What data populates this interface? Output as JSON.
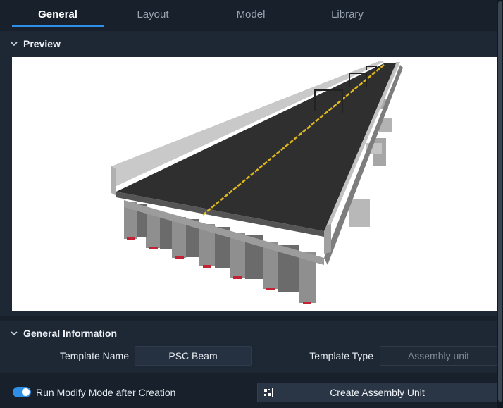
{
  "tabs": [
    {
      "label": "General",
      "active": true
    },
    {
      "label": "Layout",
      "active": false
    },
    {
      "label": "Model",
      "active": false
    },
    {
      "label": "Library",
      "active": false
    }
  ],
  "preview": {
    "title": "Preview"
  },
  "general_info": {
    "title": "General Information",
    "template_name_label": "Template Name",
    "template_name_value": "PSC Beam",
    "template_type_label": "Template Type",
    "template_type_value": "Assembly unit"
  },
  "footer": {
    "toggle_label": "Run Modify Mode after Creation",
    "toggle_on": true,
    "create_button_label": "Create Assembly Unit"
  },
  "colors": {
    "accent": "#2f8fe6",
    "background": "#17202b",
    "panel": "#1e2835"
  }
}
